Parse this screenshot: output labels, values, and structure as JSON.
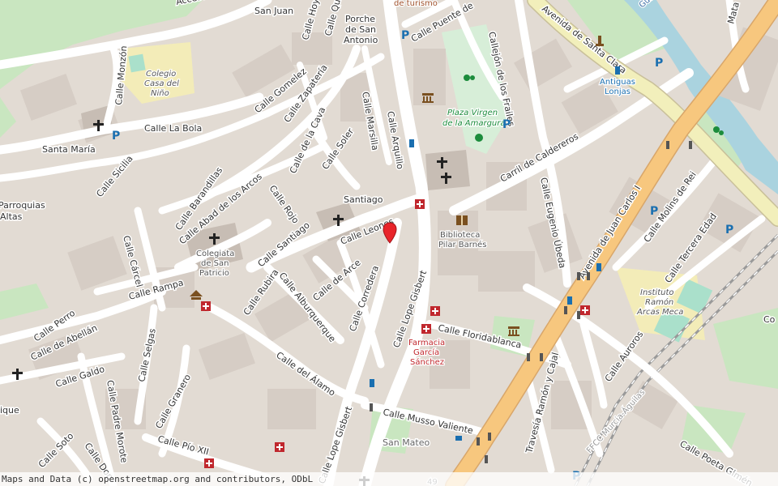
{
  "streets": {
    "acceso_castillo": "Acceso Castillo",
    "san_juan": "San Juan",
    "calle_quin": "Calle Quin",
    "calle_hoyos": "Calle Hoyos",
    "porche_san_antonio_1": "Porche",
    "porche_san_antonio_2": "de San",
    "porche_san_antonio_3": "Antonio",
    "turismo": "de turismo",
    "calle_puente": "Calle Puente de",
    "avenida_santa_clara": "Avenida de Santa Clara",
    "guadalentin": "Guadalentín",
    "calle_monzon": "Calle Monzón",
    "calle_gomelez": "Calle Gomelez",
    "calle_zapateria": "Calle Zapatería",
    "calle_la_bola": "Calle La Bola",
    "santa_maria": "Santa María",
    "calle_sicilia": "Calle Sicilia",
    "calle_de_la_cava": "Calle de la Cava",
    "calle_marsilla": "Calle Marsilla",
    "calle_arquillo": "Calle Arquillo",
    "calle_soler": "Calle Soler",
    "callejon_frailes": "Callejón de los Frailes",
    "carril_caldereros": "Carril de Caldereros",
    "calle_eugenio_ubeda": "Calle Eugenio Úbeda",
    "avenida_juan_carlos": "Avenida de Juan Carlos I",
    "calle_molins": "Calle Molins de Rei",
    "calle_tercera_edad": "Calle Tercera Edad",
    "calle_barandillas": "Calle Barandillas",
    "calle_abad": "Calle Abad de los Arcos",
    "calle_rojo": "Calle Rojo",
    "santiago": "Santiago",
    "calle_leones": "Calle Leones",
    "calle_carcel": "Calle Cárcel",
    "calle_santiago": "Calle Santiago",
    "barroquias_1": "Parroquias",
    "barroquias_2": "Altas",
    "calle_rampa": "Calle Rampa",
    "calle_rubira": "Calle Rubira",
    "calle_alburquerque": "Calle Alburquerque",
    "calle_de_arce": "Calle de Arce",
    "calle_corredera": "Calle Corredera",
    "calle_lope_gisbert": "Calle Lope Gisbert",
    "calle_floridablanca": "Calle Floridablanca",
    "calle_perro": "Calle Perro",
    "calle_abellan": "Calle de Abellán",
    "calle_selgas": "Calle Selgas",
    "calle_galdo": "Calle Galdo",
    "calle_del_alamo": "Calle del Álamo",
    "calle_padre_morote": "Calle Padre Morote",
    "calle_granero": "Calle Granero",
    "calle_musso_valiente": "Calle Musso Valiente",
    "travesia_ramon": "Travesía Ramón y Cajal",
    "calle_auroros": "Calle Auroros",
    "calle_pio_xii": "Calle Pío XII",
    "calle_soto": "Calle Soto",
    "calle_don": "Calle Don",
    "calle_lope_gisbert_2": "Calle Lope Gisbert",
    "calle_poeta_gimen": "Calle Poeta Gimén",
    "ffcc": "FFCC Murcia-Águilas",
    "ique": "ique",
    "num_49": "49",
    "con": "Co",
    "mata": "Mata"
  },
  "pois": {
    "colegio_1": "Colegio",
    "colegio_2": "Casa del",
    "colegio_3": "Niño",
    "plaza_1": "Plaza Virgen",
    "plaza_2": "de la Amargura",
    "antiguas_1": "Antiguas",
    "antiguas_2": "Lonjas",
    "biblioteca_1": "Biblioteca",
    "biblioteca_2": "Pilar Barnés",
    "colegiata_1": "Colegiata",
    "colegiata_2": "de San",
    "colegiata_3": "Patricio",
    "instituto_1": "Instituto",
    "instituto_2": "Ramón",
    "instituto_3": "Arcas Meca",
    "farmacia_1": "Farmacia",
    "farmacia_2": "García",
    "farmacia_3": "Sánchez",
    "san_mateo": "San Mateo"
  },
  "icons": {
    "parking": "P",
    "church": "✝",
    "pharmacy": "+"
  },
  "colors": {
    "background": "#e8e0d8",
    "building": "#d9d0c9",
    "road": "#ffffff",
    "primary_road": "#f7c77e",
    "secondary_road": "#f2efbb",
    "park": "#c8facc",
    "pitch": "#aae0cb",
    "water": "#aad3df",
    "marker": "#e8242a"
  },
  "attribution": "Maps and Data (c) openstreetmap.org and contributors, ODbL"
}
